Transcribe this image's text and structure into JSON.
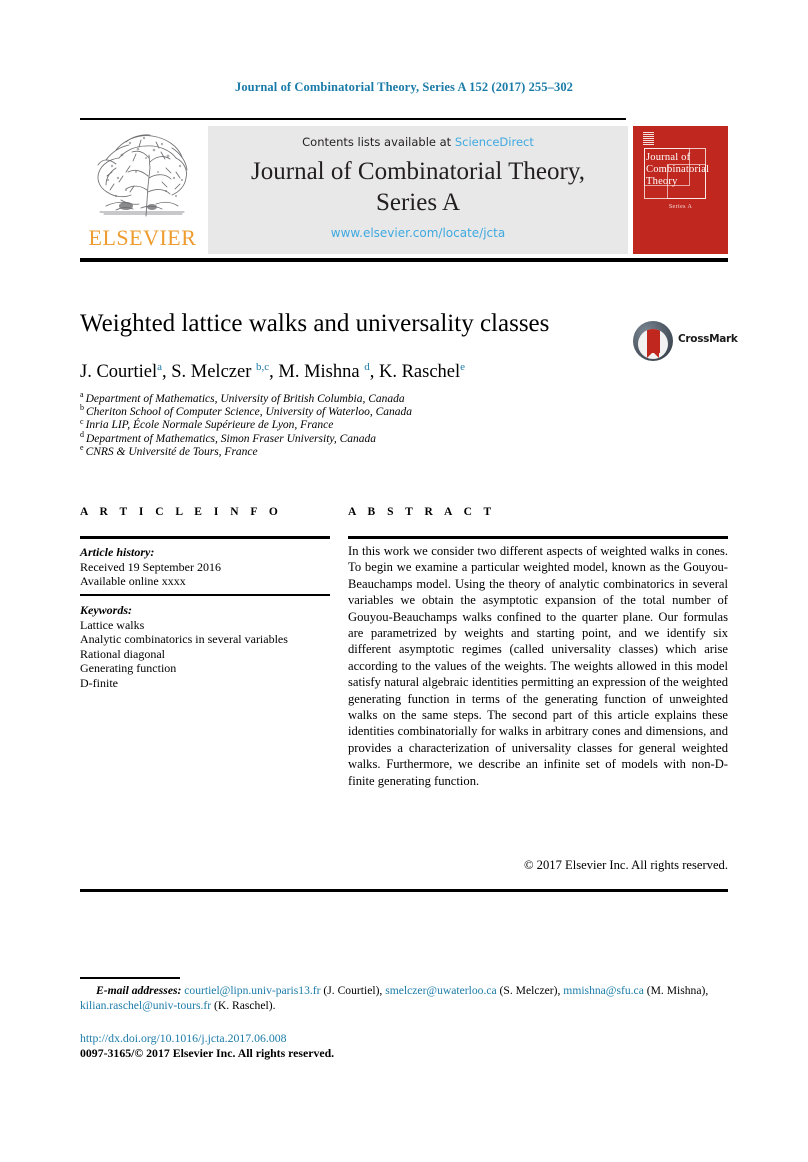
{
  "running_head": "Journal of Combinatorial Theory, Series A 152 (2017) 255–302",
  "masthead": {
    "publisher_wordmark": "ELSEVIER",
    "contents_prefix": "Contents lists available at ",
    "contents_link": "ScienceDirect",
    "journal_title_line1": "Journal of Combinatorial Theory,",
    "journal_title_line2": "Series A",
    "journal_url": "www.elsevier.com/locate/jcta",
    "cover_title": "Journal of Combinatorial Theory",
    "cover_subtitle": "Series A"
  },
  "article": {
    "title": "Weighted lattice walks and universality classes",
    "crossmark_label": "CrossMark",
    "authors_html": "J. Courtiel<sup>a</sup>, S. Melczer <sup>b,c</sup>, M. Mishna <sup>d</sup>, K. Raschel<sup>e</sup>",
    "affiliations": [
      {
        "marker": "a",
        "text": "Department of Mathematics, University of British Columbia, Canada"
      },
      {
        "marker": "b",
        "text": "Cheriton School of Computer Science, University of Waterloo, Canada"
      },
      {
        "marker": "c",
        "text": "Inria LIP, École Normale Supérieure de Lyon, France"
      },
      {
        "marker": "d",
        "text": "Department of Mathematics, Simon Fraser University, Canada"
      },
      {
        "marker": "e",
        "text": "CNRS & Université de Tours, France"
      }
    ]
  },
  "info": {
    "section_heading": "A R T I C L E    I N F O",
    "history_label": "Article history:",
    "history_lines": [
      "Received 19 September 2016",
      "Available online xxxx"
    ],
    "keywords_label": "Keywords:",
    "keywords": [
      "Lattice walks",
      "Analytic combinatorics in several variables",
      "Rational diagonal",
      "Generating function",
      "D-finite"
    ]
  },
  "abstract": {
    "section_heading": "A B S T R A C T",
    "text": "In this work we consider two different aspects of weighted walks in cones. To begin we examine a particular weighted model, known as the Gouyou-Beauchamps model. Using the theory of analytic combinatorics in several variables we obtain the asymptotic expansion of the total number of Gouyou-Beauchamps walks confined to the quarter plane. Our formulas are parametrized by weights and starting point, and we identify six different asymptotic regimes (called universality classes) which arise according to the values of the weights. The weights allowed in this model satisfy natural algebraic identities permitting an expression of the weighted generating function in terms of the generating function of unweighted walks on the same steps. The second part of this article explains these identities combinatorially for walks in arbitrary cones and dimensions, and provides a characterization of universality classes for general weighted walks. Furthermore, we describe an infinite set of models with non-D-finite generating function.",
    "copyright": "© 2017 Elsevier Inc. All rights reserved."
  },
  "footer": {
    "emails_label": "E-mail addresses:",
    "emails": [
      {
        "address": "courtiel@lipn.univ-paris13.fr",
        "person": "(J. Courtiel)"
      },
      {
        "address": "smelczer@uwaterloo.ca",
        "person": "(S. Melczer)"
      },
      {
        "address": "mmishna@sfu.ca",
        "person": "(M. Mishna)"
      },
      {
        "address": "kilian.raschel@univ-tours.fr",
        "person": "(K. Raschel)"
      }
    ],
    "doi": "http://dx.doi.org/10.1016/j.jcta.2017.06.008",
    "issn_line": "0097-3165/© 2017 Elsevier Inc. All rights reserved."
  },
  "colors": {
    "link_blue": "#1a7ba8",
    "banner_link": "#3fa9e0",
    "elsevier_orange": "#ee9b2f",
    "cover_red": "#c0281f",
    "banner_bg": "#e8e8e8"
  }
}
